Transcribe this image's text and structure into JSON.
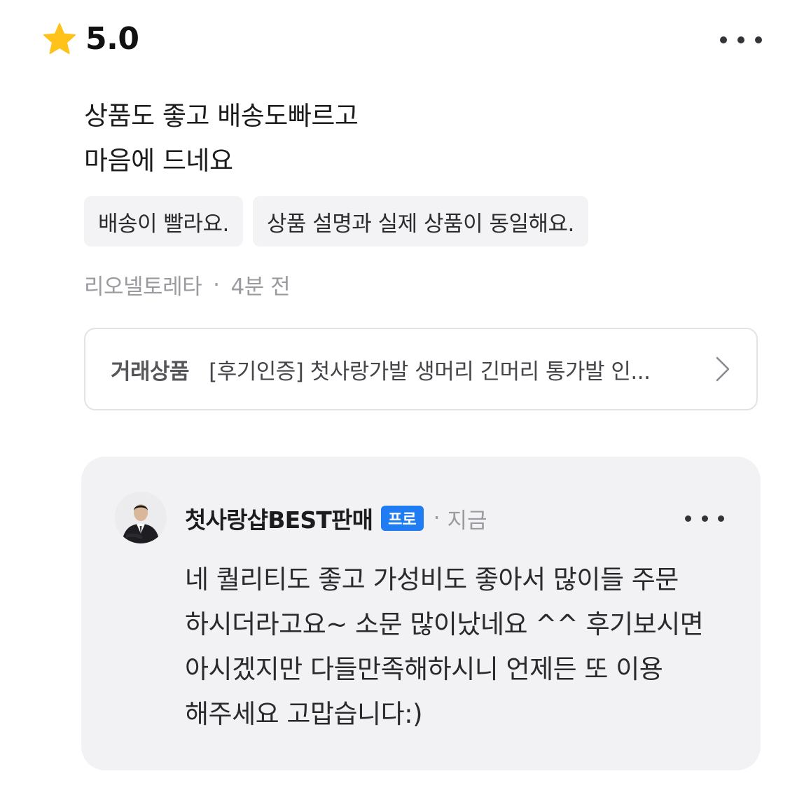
{
  "review": {
    "rating": "5.0",
    "text_lines": [
      "상품도 좋고 배송도빠르고",
      "마음에 드네요"
    ],
    "tags": [
      "배송이 빨라요.",
      "상품 설명과 실제 상품이 동일해요."
    ],
    "author": "리오넬토레타",
    "separator": "·",
    "time": "4분 전",
    "more_icon": "more-horizontal-icon",
    "star_color": "#FFC21A"
  },
  "product": {
    "label": "거래상품",
    "name": "[후기인증] 첫사랑가발 생머리 긴머리 통가발 인...",
    "chevron_icon": "chevron-right-icon"
  },
  "reply": {
    "seller_name": "첫사랑샵BEST판매",
    "badge": "프로",
    "badge_color": "#1F7CF2",
    "separator": "·",
    "time": "지금",
    "text_lines": [
      "네 퀄리티도 좋고 가성비도 좋아서 많이들 주문",
      "하시더라고요~ 소문 많이났네요 ^^ 후기보시면",
      "아시겠지만 다들만족해하시니 언제든 또 이용",
      "해주세요 고맙습니다:)"
    ],
    "more_icon": "more-horizontal-icon"
  }
}
